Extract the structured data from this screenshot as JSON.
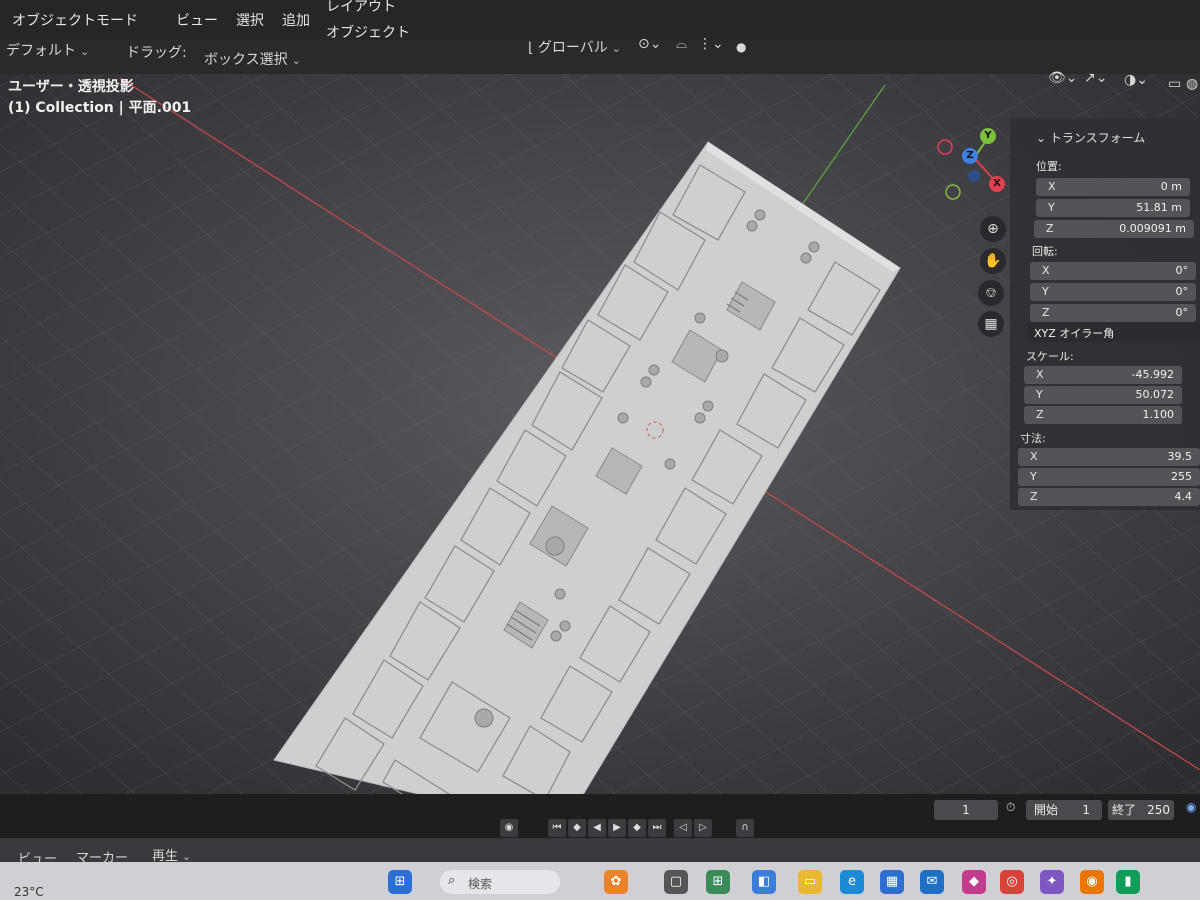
{
  "menu": {
    "items": [
      "オブジェクトモード",
      "ビュー",
      "選択",
      "追加",
      "オブジェクト"
    ],
    "workspace_tab": "レイアウト"
  },
  "toolbar": {
    "orientation_label": "デフォルト",
    "drag_label": "ドラッグ:",
    "drag_value": "ボックス選択",
    "transform_orientation": "グローバル"
  },
  "viewport": {
    "view_name": "ユーザー・透視投影",
    "collection_label": "(1) Collection | 平面.001"
  },
  "gizmo": {
    "axis_x": "X",
    "axis_y": "Y",
    "axis_z": "Z",
    "colors": {
      "x": "#e0414f",
      "y": "#7bbf3a",
      "z": "#3f7fe0"
    }
  },
  "transform_panel": {
    "title": "トランスフォーム",
    "location_label": "位置:",
    "location": [
      {
        "axis": "X",
        "value": "0 m"
      },
      {
        "axis": "Y",
        "value": "51.81 m"
      },
      {
        "axis": "Z",
        "value": "0.009091 m"
      }
    ],
    "rotation_label": "回転:",
    "rotation": [
      {
        "axis": "X",
        "value": "0°"
      },
      {
        "axis": "Y",
        "value": "0°"
      },
      {
        "axis": "Z",
        "value": "0°"
      }
    ],
    "rotation_mode": "XYZ オイラー角",
    "scale_label": "スケール:",
    "scale": [
      {
        "axis": "X",
        "value": "-45.992"
      },
      {
        "axis": "Y",
        "value": "50.072"
      },
      {
        "axis": "Z",
        "value": "1.100"
      }
    ],
    "dimensions_label": "寸法:",
    "dimensions": [
      {
        "axis": "X",
        "value": "39.5"
      },
      {
        "axis": "Y",
        "value": "255"
      },
      {
        "axis": "Z",
        "value": "4.4"
      }
    ]
  },
  "timeline": {
    "current_frame": "1",
    "start_label": "開始",
    "start_value": "1",
    "end_label": "終了",
    "end_value": "250",
    "menu": [
      "ビュー",
      "マーカー",
      "再生"
    ]
  },
  "taskbar": {
    "temperature": "23°C",
    "search_placeholder": "検索"
  }
}
